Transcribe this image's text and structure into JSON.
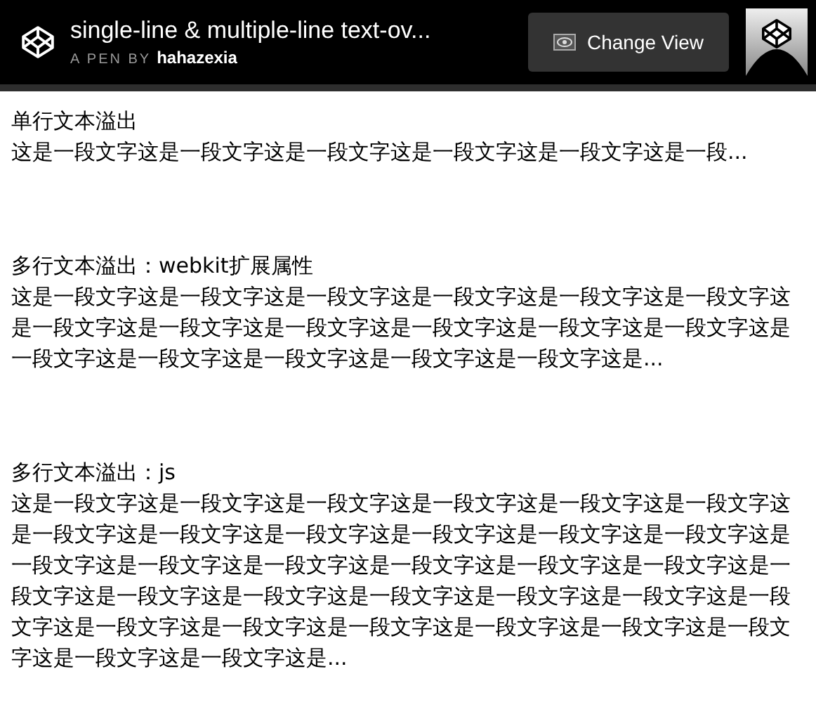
{
  "header": {
    "title": "single-line & multiple-line text-ov...",
    "byline_prefix": "A PEN BY",
    "author": "hahazexia",
    "button": "Change View"
  },
  "sections": [
    {
      "heading": "单行文本溢出",
      "text": "这是一段文字这是一段文字这是一段文字这是一段文字这是一段文字这是一段..."
    },
    {
      "heading": "多行文本溢出：webkit扩展属性",
      "text": "这是一段文字这是一段文字这是一段文字这是一段文字这是一段文字这是一段文字这是一段文字这是一段文字这是一段文字这是一段文字这是一段文字这是一段文字这是一段文字这是一段文字这是一段文字这是一段文字这是一段文字这是..."
    },
    {
      "heading": "多行文本溢出：js",
      "text": "这是一段文字这是一段文字这是一段文字这是一段文字这是一段文字这是一段文字这是一段文字这是一段文字这是一段文字这是一段文字这是一段文字这是一段文字这是一段文字这是一段文字这是一段文字这是一段文字这是一段文字这是一段文字这是一段文字这是一段文字这是一段文字这是一段文字这是一段文字这是一段文字这是一段文字这是一段文字这是一段文字这是一段文字这是一段文字这是一段文字这是一段文字这是一段文字这是一段文字这是..."
    }
  ]
}
